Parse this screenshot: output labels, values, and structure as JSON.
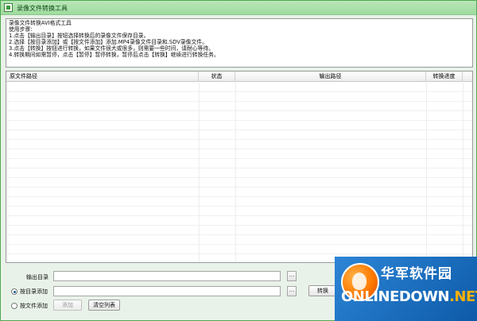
{
  "window": {
    "title": "录像文件转换工具"
  },
  "instructions": {
    "lines": [
      "录像文件转换AVI格式工具",
      "使用步骤:",
      "1.点击【输出目录】按钮选择转换后的录像文件保存目录。",
      "2.选择【按目录添加】或【按文件添加】添加.MP4录像文件目录和.SDV录像文件。",
      "3.点击【转换】按钮进行转换，如果文件很大或很多，则需要一些时间，请耐心等待。",
      "4.转换期间如需暂停，点击【暂停】暂停转换，暂停后点击【转换】继续进行转换任务。"
    ]
  },
  "table": {
    "columns": [
      "原文件路径",
      "状态",
      "输出路径",
      "转换进度"
    ],
    "rows": []
  },
  "controls": {
    "output_dir_label": "输出目录",
    "output_dir_value": "",
    "browse_label": "...",
    "add_by_dir_label": "按目录添加",
    "add_by_dir_value": "",
    "add_by_file_label": "按文件添加",
    "add_button_label": "添加",
    "clear_list_label": "清空列表",
    "convert_label": "转换",
    "mode_selected": "按目录添加"
  },
  "watermark": {
    "cn_text": "华军软件园",
    "en_text_a": "ONLINEDOWN",
    "en_text_b": ".NET"
  },
  "colors": {
    "titlebar": "#a8dea8",
    "window_bg": "#e9f2e9",
    "watermark_bg": "#1a6fc2",
    "watermark_accent": "#ff8a00"
  }
}
